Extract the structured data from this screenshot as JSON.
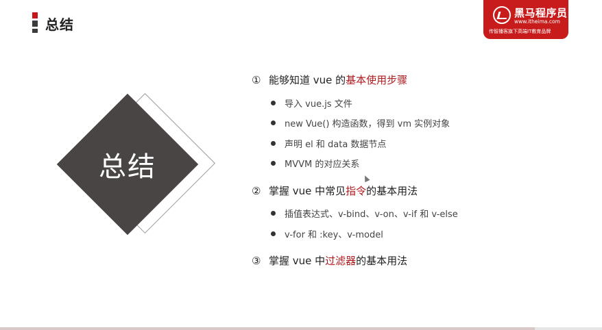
{
  "header": {
    "title": "总结"
  },
  "logo": {
    "name": "黑马程序员",
    "url": "www.itheima.com",
    "slogan": "传智播客旗下高端IT教育品牌"
  },
  "center_graphic": {
    "label": "总结"
  },
  "sections": [
    {
      "num": "①",
      "prefix": "能够知道 vue 的",
      "highlight": "基本使用步骤",
      "suffix": "",
      "items": [
        "导入 vue.js 文件",
        "new Vue() 构造函数，得到 vm 实例对象",
        "声明 el 和 data 数据节点",
        "MVVM 的对应关系"
      ]
    },
    {
      "num": "②",
      "prefix": "掌握 vue 中常见",
      "highlight": "指令",
      "suffix": "的基本用法",
      "items": [
        "插值表达式、v-bind、v-on、v-if 和 v-else",
        "v-for 和 :key、v-model"
      ]
    },
    {
      "num": "③",
      "prefix": "掌握 vue 中",
      "highlight": "过滤器",
      "suffix": "的基本用法",
      "items": []
    }
  ],
  "colors": {
    "accent": "#b0191e",
    "brand": "#c81c1c",
    "diamond": "#4a4545"
  }
}
